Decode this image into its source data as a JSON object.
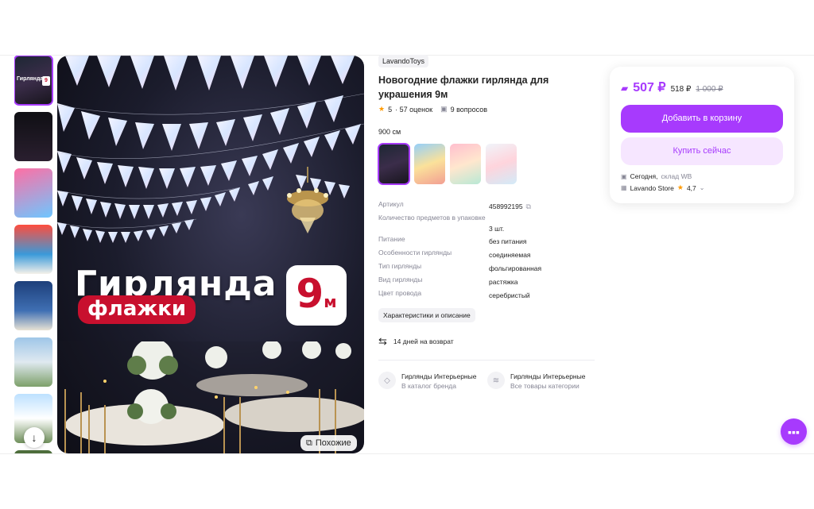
{
  "gallery": {
    "thumb_labels": [
      "Гирлянда",
      "",
      "",
      "",
      "",
      "",
      "",
      ""
    ],
    "hero_title": "Гирлянда",
    "hero_subtitle": "флажки",
    "hero_badge_number": "9",
    "hero_badge_unit": "м",
    "similar_label": "Похожие"
  },
  "product": {
    "brand": "LavandoToys",
    "title": "Новогодние флажки гирлянда для украшения 9м",
    "rating": "5",
    "reviews": "· 57 оценок",
    "questions": "9 вопросов",
    "size": "900 см"
  },
  "specs": [
    {
      "key": "Артикул",
      "value": "458992195"
    },
    {
      "key": "Количество предметов в упаковке",
      "value": "3 шт."
    },
    {
      "key": "Питание",
      "value": "без питания"
    },
    {
      "key": "Особенности гирлянды",
      "value": "соединяемая"
    },
    {
      "key": "Тип гирлянды",
      "value": "фольгированная"
    },
    {
      "key": "Вид гирлянды",
      "value": "растяжка"
    },
    {
      "key": "Цвет провода",
      "value": "серебристый"
    }
  ],
  "details_button": "Характеристики и описание",
  "return_policy": "14 дней на возврат",
  "category_links": [
    {
      "title": "Гирлянды Интерьерные",
      "subtitle": "В каталог бренда"
    },
    {
      "title": "Гирлянды Интерьерные",
      "subtitle": "Все товары категории"
    }
  ],
  "buybox": {
    "price_wallet": "507 ₽",
    "price_regular": "518 ₽",
    "price_old": "1 000 ₽",
    "add_to_cart": "Добавить в корзину",
    "buy_now": "Купить сейчас",
    "delivery_day": "Сегодня,",
    "delivery_warehouse": "склад WB",
    "seller_name": "Lavando Store",
    "seller_rating": "4,7"
  },
  "colors": {
    "accent": "#a73afd",
    "accent_light": "#f6e6ff",
    "star": "#ff9a00",
    "hero_red": "#c8102e"
  },
  "icons": [
    "arrow-down-icon",
    "similar-icon",
    "star-icon",
    "question-icon",
    "copy-icon",
    "return-icon",
    "tag-icon",
    "stack-icon",
    "wallet-icon",
    "box-icon",
    "store-icon",
    "chevron-down-icon",
    "chat-icon"
  ]
}
